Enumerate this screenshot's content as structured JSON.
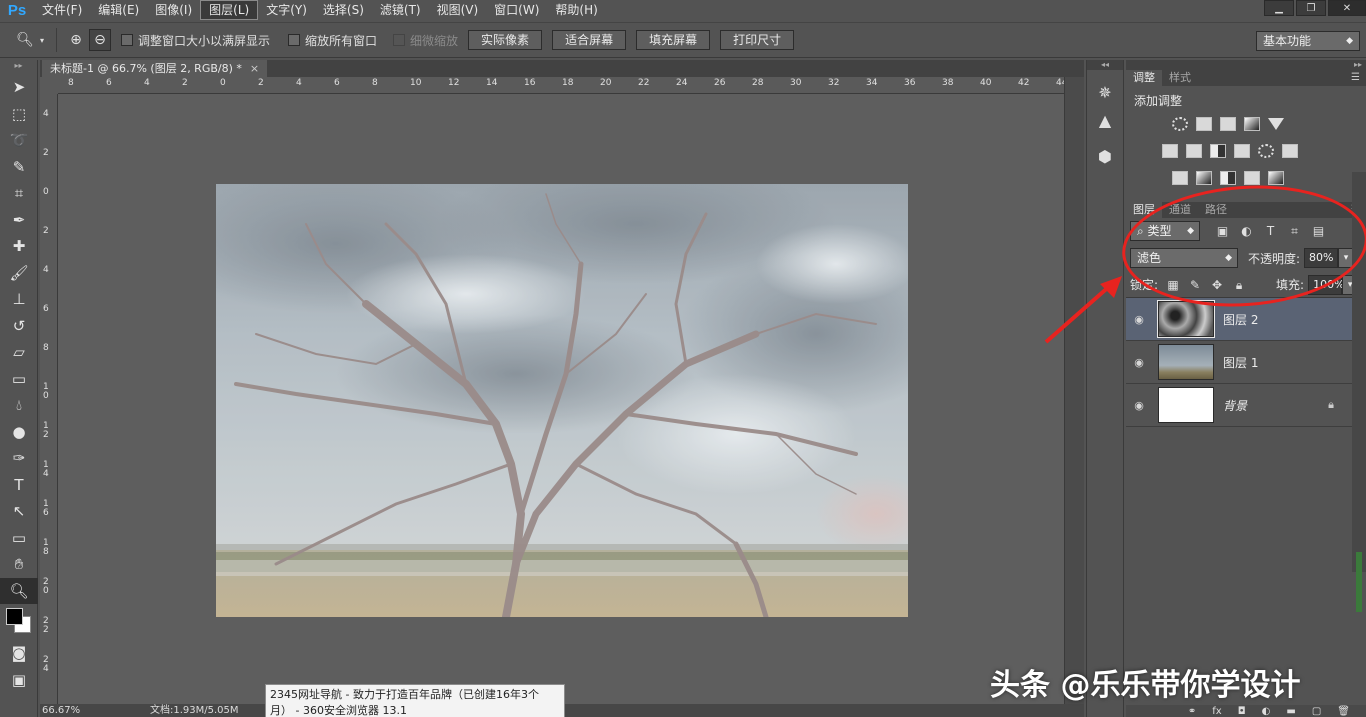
{
  "app": {
    "logo": "Ps"
  },
  "menu": [
    "文件(F)",
    "编辑(E)",
    "图像(I)",
    "图层(L)",
    "文字(Y)",
    "选择(S)",
    "滤镜(T)",
    "视图(V)",
    "窗口(W)",
    "帮助(H)"
  ],
  "menu_active_index": 3,
  "options": {
    "resize_windows": "调整窗口大小以满屏显示",
    "zoom_all": "缩放所有窗口",
    "scrubby_zoom": "细微缩放",
    "actual_pixels": "实际像素",
    "fit_screen": "适合屏幕",
    "fill_screen": "填充屏幕",
    "print_size": "打印尺寸",
    "workspace": "基本功能"
  },
  "document": {
    "tab_title": "未标题-1 @ 66.7% (图层 2, RGB/8) *",
    "close": "×"
  },
  "ruler": {
    "h_labels": [
      "8",
      "6",
      "4",
      "2",
      "0",
      "2",
      "4",
      "6",
      "8",
      "10",
      "12",
      "14",
      "16",
      "18",
      "20",
      "22",
      "24",
      "26",
      "28",
      "30",
      "32",
      "34",
      "36",
      "38",
      "40",
      "42",
      "44"
    ],
    "v_labels": [
      "4",
      "2",
      "0",
      "2",
      "4",
      "6",
      "8",
      "1 0",
      "1 2",
      "1 4",
      "1 6",
      "1 8",
      "2 0",
      "2 2",
      "2 4"
    ]
  },
  "status": {
    "zoom": "66.67%",
    "doc": "文档:1.93M/5.05M"
  },
  "tooltip": {
    "line1": "2345网址导航 - 致力于打造百年品牌（已创建16年3个",
    "line2": "月） - 360安全浏览器 13.1"
  },
  "adjustments": {
    "tabs": [
      "调整",
      "样式"
    ],
    "title": "添加调整"
  },
  "layers_panel": {
    "tabs": [
      "图层",
      "通道",
      "路径"
    ],
    "filter_kind": "类型",
    "blend_mode": "滤色",
    "opacity_label": "不透明度:",
    "opacity_value": "80%",
    "lock_label": "锁定:",
    "fill_label": "填充:",
    "fill_value": "100%",
    "layers": [
      {
        "name": "图层 2",
        "selected": true
      },
      {
        "name": "图层 1",
        "selected": false
      },
      {
        "name": "背景",
        "selected": false,
        "locked": true
      }
    ]
  },
  "watermark": "头条 @乐乐带你学设计",
  "colors": {
    "annotation": "#e8231f",
    "selected_layer": "#5a6374",
    "ps_blue": "#31a8ff"
  }
}
